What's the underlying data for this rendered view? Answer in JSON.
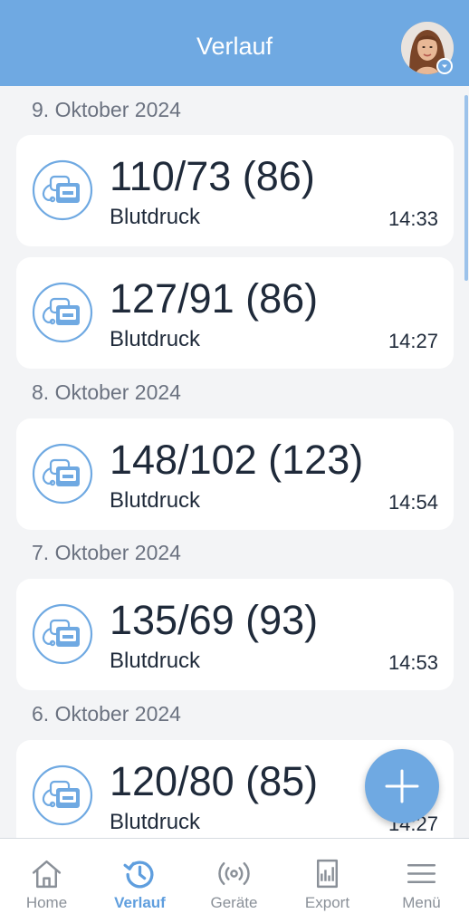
{
  "header": {
    "title": "Verlauf"
  },
  "colors": {
    "accent": "#6fa9e2",
    "background": "#f3f4f6",
    "card": "#ffffff",
    "text": "#1f2a3a",
    "muted": "#6b7280"
  },
  "groups": [
    {
      "date": "9. Oktober 2024",
      "entries": [
        {
          "value": "110/73 (86)",
          "type": "Blutdruck",
          "time": "14:33",
          "icon": "blood-pressure-monitor-icon"
        },
        {
          "value": "127/91 (86)",
          "type": "Blutdruck",
          "time": "14:27",
          "icon": "blood-pressure-monitor-icon"
        }
      ]
    },
    {
      "date": "8. Oktober 2024",
      "entries": [
        {
          "value": "148/102 (123)",
          "type": "Blutdruck",
          "time": "14:54",
          "icon": "blood-pressure-monitor-icon"
        }
      ]
    },
    {
      "date": "7. Oktober 2024",
      "entries": [
        {
          "value": "135/69 (93)",
          "type": "Blutdruck",
          "time": "14:53",
          "icon": "blood-pressure-monitor-icon"
        }
      ]
    },
    {
      "date": "6. Oktober 2024",
      "entries": [
        {
          "value": "120/80 (85)",
          "type": "Blutdruck",
          "time": "14:27",
          "icon": "blood-pressure-monitor-icon"
        }
      ]
    }
  ],
  "fab": {
    "icon": "plus-icon"
  },
  "nav": {
    "items": [
      {
        "label": "Home",
        "icon": "home-icon",
        "active": false
      },
      {
        "label": "Verlauf",
        "icon": "history-icon",
        "active": true
      },
      {
        "label": "Geräte",
        "icon": "broadcast-icon",
        "active": false
      },
      {
        "label": "Export",
        "icon": "document-icon",
        "active": false
      },
      {
        "label": "Menü",
        "icon": "menu-icon",
        "active": false
      }
    ]
  }
}
